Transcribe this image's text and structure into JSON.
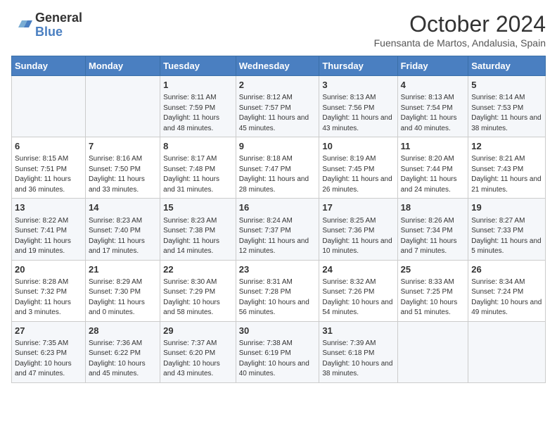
{
  "header": {
    "logo_general": "General",
    "logo_blue": "Blue",
    "month_title": "October 2024",
    "subtitle": "Fuensanta de Martos, Andalusia, Spain"
  },
  "days_of_week": [
    "Sunday",
    "Monday",
    "Tuesday",
    "Wednesday",
    "Thursday",
    "Friday",
    "Saturday"
  ],
  "weeks": [
    [
      {
        "day": "",
        "info": ""
      },
      {
        "day": "",
        "info": ""
      },
      {
        "day": "1",
        "info": "Sunrise: 8:11 AM\nSunset: 7:59 PM\nDaylight: 11 hours and 48 minutes."
      },
      {
        "day": "2",
        "info": "Sunrise: 8:12 AM\nSunset: 7:57 PM\nDaylight: 11 hours and 45 minutes."
      },
      {
        "day": "3",
        "info": "Sunrise: 8:13 AM\nSunset: 7:56 PM\nDaylight: 11 hours and 43 minutes."
      },
      {
        "day": "4",
        "info": "Sunrise: 8:13 AM\nSunset: 7:54 PM\nDaylight: 11 hours and 40 minutes."
      },
      {
        "day": "5",
        "info": "Sunrise: 8:14 AM\nSunset: 7:53 PM\nDaylight: 11 hours and 38 minutes."
      }
    ],
    [
      {
        "day": "6",
        "info": "Sunrise: 8:15 AM\nSunset: 7:51 PM\nDaylight: 11 hours and 36 minutes."
      },
      {
        "day": "7",
        "info": "Sunrise: 8:16 AM\nSunset: 7:50 PM\nDaylight: 11 hours and 33 minutes."
      },
      {
        "day": "8",
        "info": "Sunrise: 8:17 AM\nSunset: 7:48 PM\nDaylight: 11 hours and 31 minutes."
      },
      {
        "day": "9",
        "info": "Sunrise: 8:18 AM\nSunset: 7:47 PM\nDaylight: 11 hours and 28 minutes."
      },
      {
        "day": "10",
        "info": "Sunrise: 8:19 AM\nSunset: 7:45 PM\nDaylight: 11 hours and 26 minutes."
      },
      {
        "day": "11",
        "info": "Sunrise: 8:20 AM\nSunset: 7:44 PM\nDaylight: 11 hours and 24 minutes."
      },
      {
        "day": "12",
        "info": "Sunrise: 8:21 AM\nSunset: 7:43 PM\nDaylight: 11 hours and 21 minutes."
      }
    ],
    [
      {
        "day": "13",
        "info": "Sunrise: 8:22 AM\nSunset: 7:41 PM\nDaylight: 11 hours and 19 minutes."
      },
      {
        "day": "14",
        "info": "Sunrise: 8:23 AM\nSunset: 7:40 PM\nDaylight: 11 hours and 17 minutes."
      },
      {
        "day": "15",
        "info": "Sunrise: 8:23 AM\nSunset: 7:38 PM\nDaylight: 11 hours and 14 minutes."
      },
      {
        "day": "16",
        "info": "Sunrise: 8:24 AM\nSunset: 7:37 PM\nDaylight: 11 hours and 12 minutes."
      },
      {
        "day": "17",
        "info": "Sunrise: 8:25 AM\nSunset: 7:36 PM\nDaylight: 11 hours and 10 minutes."
      },
      {
        "day": "18",
        "info": "Sunrise: 8:26 AM\nSunset: 7:34 PM\nDaylight: 11 hours and 7 minutes."
      },
      {
        "day": "19",
        "info": "Sunrise: 8:27 AM\nSunset: 7:33 PM\nDaylight: 11 hours and 5 minutes."
      }
    ],
    [
      {
        "day": "20",
        "info": "Sunrise: 8:28 AM\nSunset: 7:32 PM\nDaylight: 11 hours and 3 minutes."
      },
      {
        "day": "21",
        "info": "Sunrise: 8:29 AM\nSunset: 7:30 PM\nDaylight: 11 hours and 0 minutes."
      },
      {
        "day": "22",
        "info": "Sunrise: 8:30 AM\nSunset: 7:29 PM\nDaylight: 10 hours and 58 minutes."
      },
      {
        "day": "23",
        "info": "Sunrise: 8:31 AM\nSunset: 7:28 PM\nDaylight: 10 hours and 56 minutes."
      },
      {
        "day": "24",
        "info": "Sunrise: 8:32 AM\nSunset: 7:26 PM\nDaylight: 10 hours and 54 minutes."
      },
      {
        "day": "25",
        "info": "Sunrise: 8:33 AM\nSunset: 7:25 PM\nDaylight: 10 hours and 51 minutes."
      },
      {
        "day": "26",
        "info": "Sunrise: 8:34 AM\nSunset: 7:24 PM\nDaylight: 10 hours and 49 minutes."
      }
    ],
    [
      {
        "day": "27",
        "info": "Sunrise: 7:35 AM\nSunset: 6:23 PM\nDaylight: 10 hours and 47 minutes."
      },
      {
        "day": "28",
        "info": "Sunrise: 7:36 AM\nSunset: 6:22 PM\nDaylight: 10 hours and 45 minutes."
      },
      {
        "day": "29",
        "info": "Sunrise: 7:37 AM\nSunset: 6:20 PM\nDaylight: 10 hours and 43 minutes."
      },
      {
        "day": "30",
        "info": "Sunrise: 7:38 AM\nSunset: 6:19 PM\nDaylight: 10 hours and 40 minutes."
      },
      {
        "day": "31",
        "info": "Sunrise: 7:39 AM\nSunset: 6:18 PM\nDaylight: 10 hours and 38 minutes."
      },
      {
        "day": "",
        "info": ""
      },
      {
        "day": "",
        "info": ""
      }
    ]
  ]
}
